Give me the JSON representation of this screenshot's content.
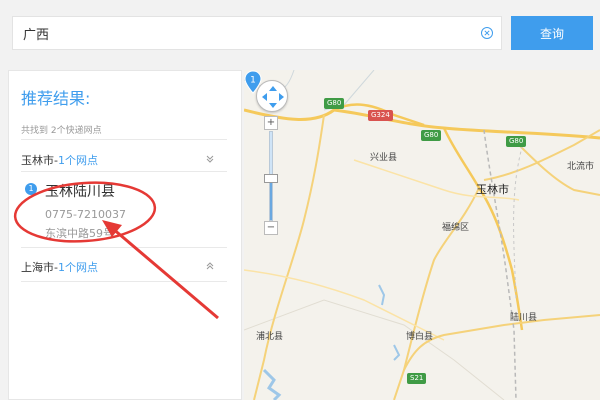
{
  "search": {
    "value": "广西",
    "button_label": "查询"
  },
  "results": {
    "title": "推荐结果:",
    "found_text": "共找到 2个快递网点",
    "cities": [
      {
        "name": "玉林市-",
        "count": "1个网点",
        "expanded": true
      },
      {
        "name": "上海市-",
        "count": "1个网点",
        "expanded": false
      }
    ],
    "store": {
      "index": "1",
      "name": "玉林陆川县",
      "phone": "0775-7210037",
      "address": "东滨中路59号"
    }
  },
  "map": {
    "labels": {
      "xingye": "兴业县",
      "yulin": "玉林市",
      "beiliu": "北流市",
      "fumian": "福绵区",
      "pubei": "浦北县",
      "bobai": "博白县",
      "luchuan": "陆川县"
    },
    "shields": {
      "g80_a": "G80",
      "g324": "G324",
      "g80_b": "G80",
      "g80_c": "G80",
      "s21": "S21"
    },
    "marker_index": "1"
  },
  "colors": {
    "accent": "#3f9ded",
    "annotation": "#e53935"
  },
  "icons": {
    "clear": "clear-circle-icon",
    "pan": "pan-arrows-icon",
    "marker": "map-marker-icon"
  }
}
